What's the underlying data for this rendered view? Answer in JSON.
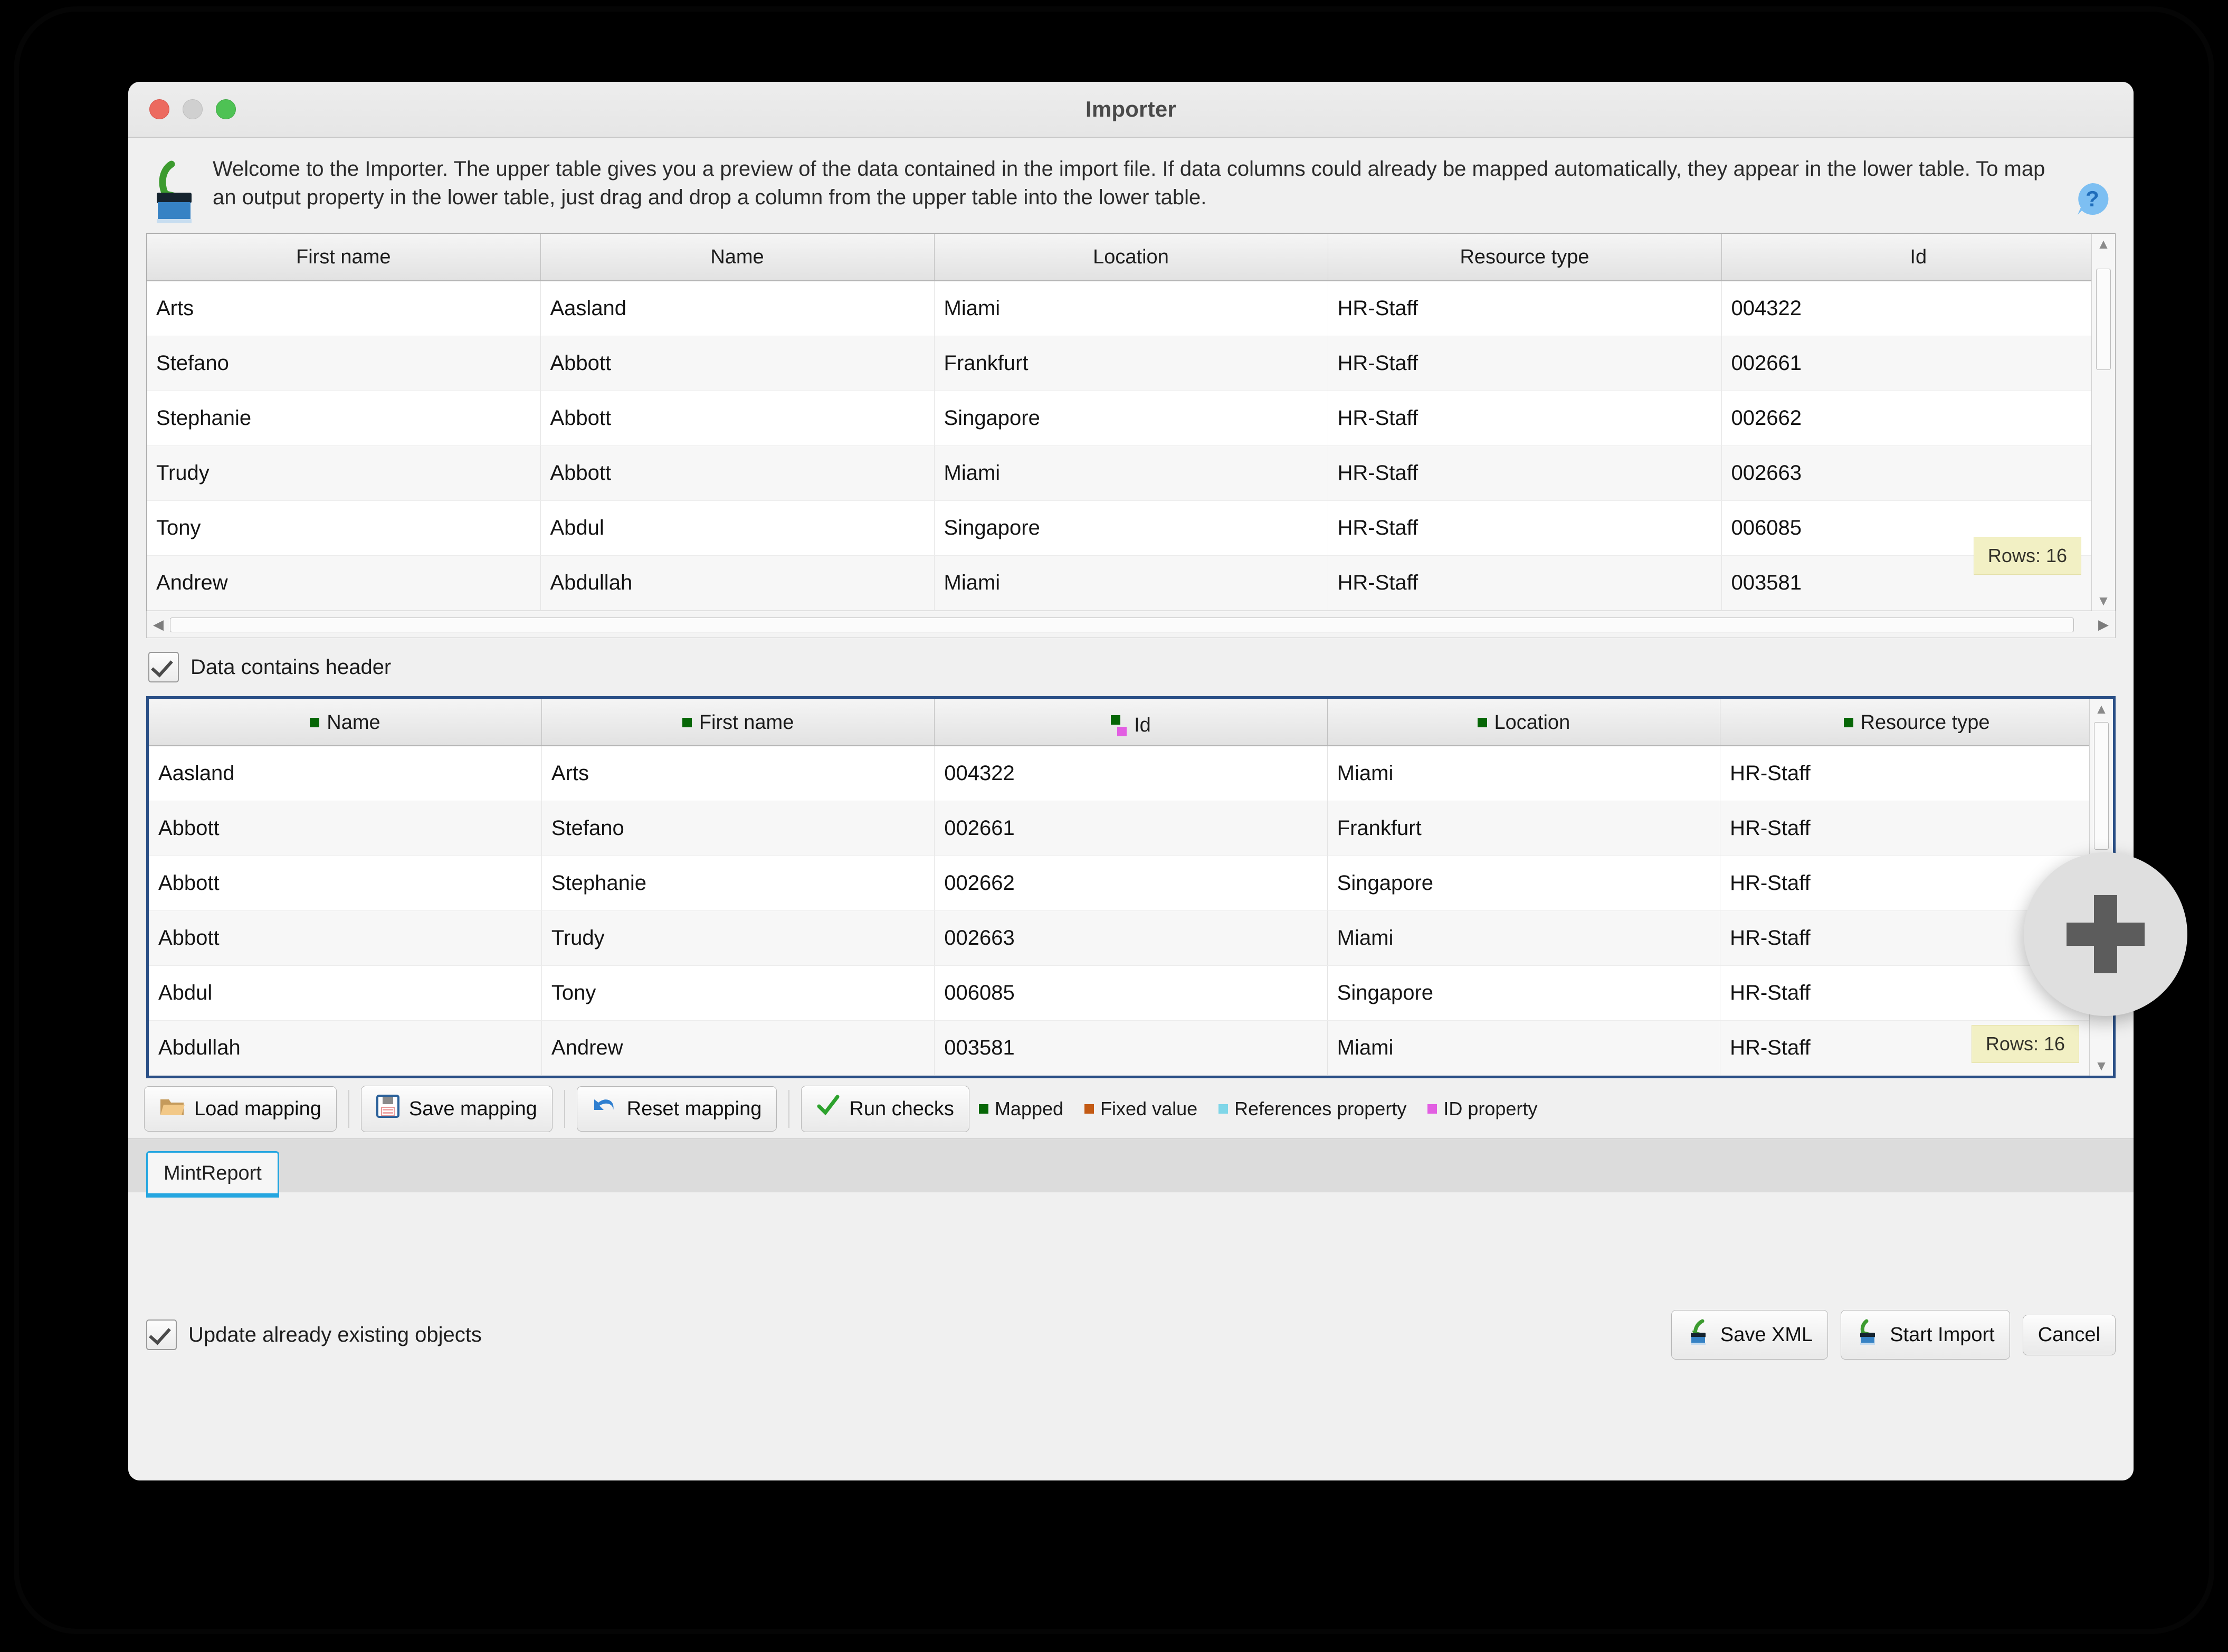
{
  "window": {
    "title": "Importer",
    "traffic_lights": [
      "close-red",
      "minimize-gray",
      "zoom-green"
    ]
  },
  "intro": {
    "text": "Welcome to the Importer. The upper table gives you a preview of the data contained in the import file. If data columns could already be mapped automatically, they appear in the lower table. To map an output property in the lower table, just drag and drop a column from the upper table into the lower table.",
    "icon": "import-plant-icon",
    "help_icon": "help-question-icon"
  },
  "preview_table": {
    "columns": [
      "First name",
      "Name",
      "Location",
      "Resource type",
      "Id"
    ],
    "rows": [
      [
        "Arts",
        "Aasland",
        "Miami",
        "HR-Staff",
        "004322"
      ],
      [
        "Stefano",
        "Abbott",
        "Frankfurt",
        "HR-Staff",
        "002661"
      ],
      [
        "Stephanie",
        "Abbott",
        "Singapore",
        "HR-Staff",
        "002662"
      ],
      [
        "Trudy",
        "Abbott",
        "Miami",
        "HR-Staff",
        "002663"
      ],
      [
        "Tony",
        "Abdul",
        "Singapore",
        "HR-Staff",
        "006085"
      ],
      [
        "Andrew",
        "Abdullah",
        "Miami",
        "HR-Staff",
        "003581"
      ]
    ],
    "rows_badge": "Rows: 16"
  },
  "header_checkbox": {
    "label": "Data contains header",
    "checked": true
  },
  "mapping_table": {
    "columns": [
      {
        "label": "Name",
        "markers": [
          "mapped"
        ]
      },
      {
        "label": "First name",
        "markers": [
          "mapped"
        ]
      },
      {
        "label": "Id",
        "markers": [
          "mapped",
          "id_property"
        ]
      },
      {
        "label": "Location",
        "markers": [
          "mapped"
        ]
      },
      {
        "label": "Resource type",
        "markers": [
          "mapped"
        ]
      }
    ],
    "rows": [
      [
        "Aasland",
        "Arts",
        "004322",
        "Miami",
        "HR-Staff"
      ],
      [
        "Abbott",
        "Stefano",
        "002661",
        "Frankfurt",
        "HR-Staff"
      ],
      [
        "Abbott",
        "Stephanie",
        "002662",
        "Singapore",
        "HR-Staff"
      ],
      [
        "Abbott",
        "Trudy",
        "002663",
        "Miami",
        "HR-Staff"
      ],
      [
        "Abdul",
        "Tony",
        "006085",
        "Singapore",
        "HR-Staff"
      ],
      [
        "Abdullah",
        "Andrew",
        "003581",
        "Miami",
        "HR-Staff"
      ]
    ],
    "rows_badge": "Rows: 16"
  },
  "toolbar": {
    "load_mapping": "Load mapping",
    "save_mapping": "Save mapping",
    "reset_mapping": "Reset mapping",
    "run_checks": "Run checks"
  },
  "legend": [
    {
      "label": "Mapped",
      "color": "#066606"
    },
    {
      "label": "Fixed value",
      "color": "#c35a14"
    },
    {
      "label": "References property",
      "color": "#7fd6e8"
    },
    {
      "label": "ID property",
      "color": "#e25fe2"
    }
  ],
  "tabs": [
    {
      "label": "MintReport",
      "active": true
    }
  ],
  "footer": {
    "update_checkbox": {
      "label": "Update already existing objects",
      "checked": true
    },
    "save_xml": "Save XML",
    "start_import": "Start Import",
    "cancel": "Cancel"
  },
  "floating_action": {
    "icon": "plus-icon"
  },
  "colors": {
    "mapped": "#066606",
    "fixed_value": "#c35a14",
    "references_property": "#7fd6e8",
    "id_property": "#e25fe2",
    "focus_border": "#2a4f86",
    "tab_accent": "#25a6e0",
    "badge_bg": "#f2f0c4"
  }
}
